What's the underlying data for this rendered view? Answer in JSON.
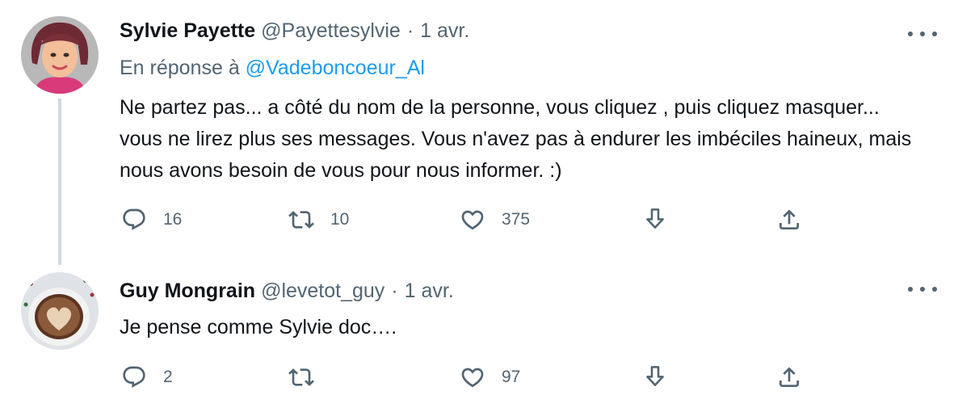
{
  "colors": {
    "text": "#0f1419",
    "secondary": "#536471",
    "link": "#1d9bf0",
    "thread_line": "#cfd9de"
  },
  "tweets": [
    {
      "name": "Sylvie Payette",
      "handle": "@Payettesylvie",
      "separator": "·",
      "date": "1 avr.",
      "reply_prefix": "En réponse à",
      "reply_handle": "@Vadeboncoeur_Al",
      "text": "Ne partez pas... a côté du nom de la personne, vous cliquez , puis cliquez masquer... vous ne lirez plus ses messages. Vous n'avez pas à endurer les imbéciles haineux, mais nous avons besoin de vous pour nous informer. :)",
      "replies": "16",
      "retweets": "10",
      "likes": "375",
      "icons": [
        "reply-icon",
        "retweet-icon",
        "like-icon",
        "download-icon",
        "share-icon",
        "more-icon"
      ]
    },
    {
      "name": "Guy Mongrain",
      "handle": "@levetot_guy",
      "separator": "·",
      "date": "1 avr.",
      "text": "Je pense comme Sylvie doc….",
      "replies": "2",
      "retweets": "",
      "likes": "97",
      "icons": [
        "reply-icon",
        "retweet-icon",
        "like-icon",
        "download-icon",
        "share-icon",
        "more-icon"
      ]
    }
  ]
}
